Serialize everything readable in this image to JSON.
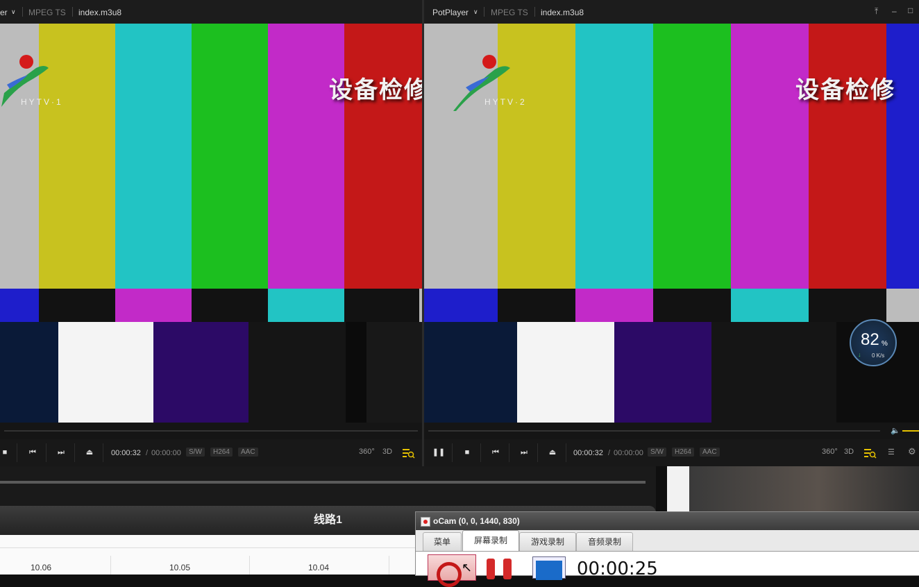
{
  "left_player": {
    "app_label": "er",
    "format": "MPEG TS",
    "filename": "index.m3u8",
    "logo_text": "HYTV·1",
    "overlay": "设备检修",
    "time_current": "00:00:32",
    "time_sep": "/",
    "time_total": "00:00:00",
    "tags": [
      "S/W",
      "H264",
      "AAC"
    ],
    "icons": [
      "360-icon",
      "3d-icon",
      "playlist-search-icon"
    ],
    "icon_labels": {
      "vr": "360°",
      "d3": "3D"
    }
  },
  "right_player": {
    "app_label": "PotPlayer",
    "format": "MPEG TS",
    "filename": "index.m3u8",
    "logo_text": "HYTV·2",
    "overlay": "设备检修",
    "time_current": "00:00:32",
    "time_sep": "/",
    "time_total": "00:00:00",
    "tags": [
      "S/W",
      "H264",
      "AAC"
    ],
    "icon_labels": {
      "vr": "360°",
      "d3": "3D"
    }
  },
  "speed_widget": {
    "percent": "82",
    "percent_sign": "%",
    "rate": "0 K/s"
  },
  "table": {
    "header": "线路1",
    "cells": [
      "10.06",
      "10.05",
      "10.04"
    ]
  },
  "ocam": {
    "title": "oCam (0, 0, 1440, 830)",
    "tabs": [
      "菜单",
      "屏幕录制",
      "游戏录制",
      "音频录制"
    ],
    "active_tab": "屏幕录制",
    "timer": "00:00:25"
  },
  "colors": {
    "bar_gray": "#bcbcbc",
    "bar_yellow": "#c8c21f",
    "bar_cyan": "#22c4c4",
    "bar_green": "#1cbf1f",
    "bar_magenta": "#c22ac8",
    "bar_red": "#c41818",
    "bar_blue": "#1e1ecb",
    "accent_yellow": "#e6c200"
  }
}
